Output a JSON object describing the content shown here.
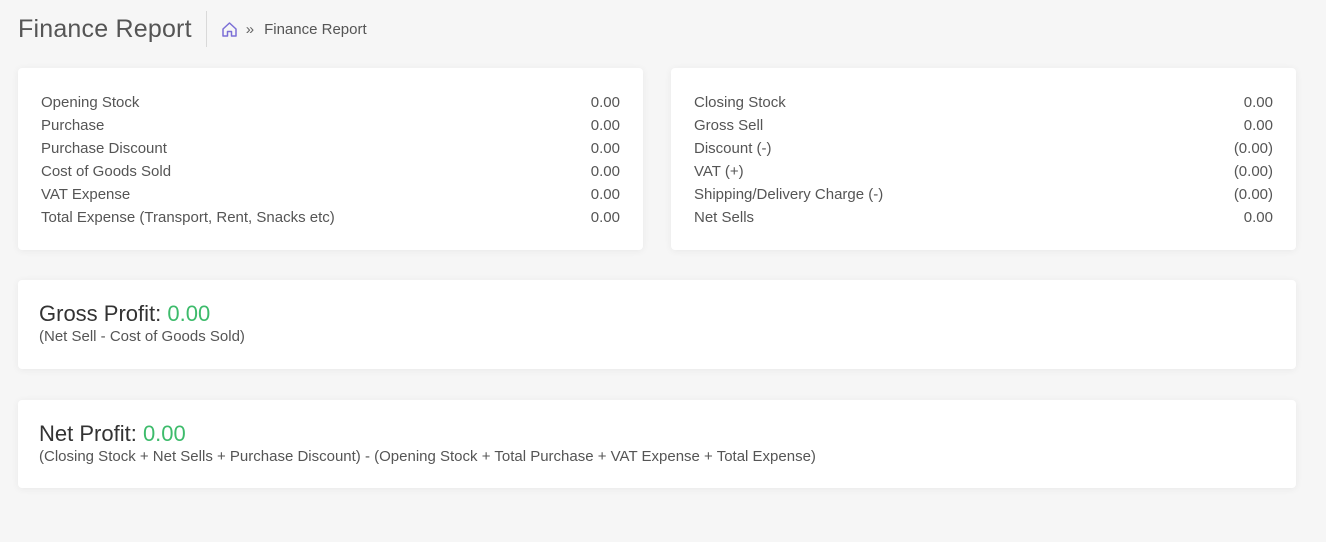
{
  "header": {
    "title": "Finance Report",
    "breadcrumb": {
      "home_icon": "home-icon",
      "separator": "»",
      "current": "Finance Report"
    }
  },
  "left_card": {
    "rows": [
      {
        "label": "Opening Stock",
        "value": "0.00"
      },
      {
        "label": "Purchase",
        "value": "0.00"
      },
      {
        "label": "Purchase Discount",
        "value": "0.00"
      },
      {
        "label": "Cost of Goods Sold",
        "value": "0.00"
      },
      {
        "label": "VAT Expense",
        "value": "0.00"
      },
      {
        "label": "Total Expense (Transport, Rent, Snacks etc)",
        "value": "0.00"
      }
    ]
  },
  "right_card": {
    "rows": [
      {
        "label": "Closing Stock",
        "value": "0.00"
      },
      {
        "label": "Gross Sell",
        "value": "0.00"
      },
      {
        "label": "Discount (-)",
        "value": "(0.00)"
      },
      {
        "label": "VAT (+)",
        "value": "(0.00)"
      },
      {
        "label": "Shipping/Delivery Charge (-)",
        "value": "(0.00)"
      },
      {
        "label": "Net Sells",
        "value": "0.00"
      }
    ]
  },
  "gross_profit": {
    "label": "Gross Profit:",
    "value": "0.00",
    "formula": "(Net Sell - Cost of Goods Sold)"
  },
  "net_profit": {
    "label": "Net Profit:",
    "value": "0.00",
    "formula": "(Closing Stock + Net Sells + Purchase Discount) - (Opening Stock + Total Purchase + VAT Expense + Total Expense)"
  },
  "colors": {
    "profit_value": "#3dbb6b",
    "home_icon": "#7b6fd6"
  }
}
